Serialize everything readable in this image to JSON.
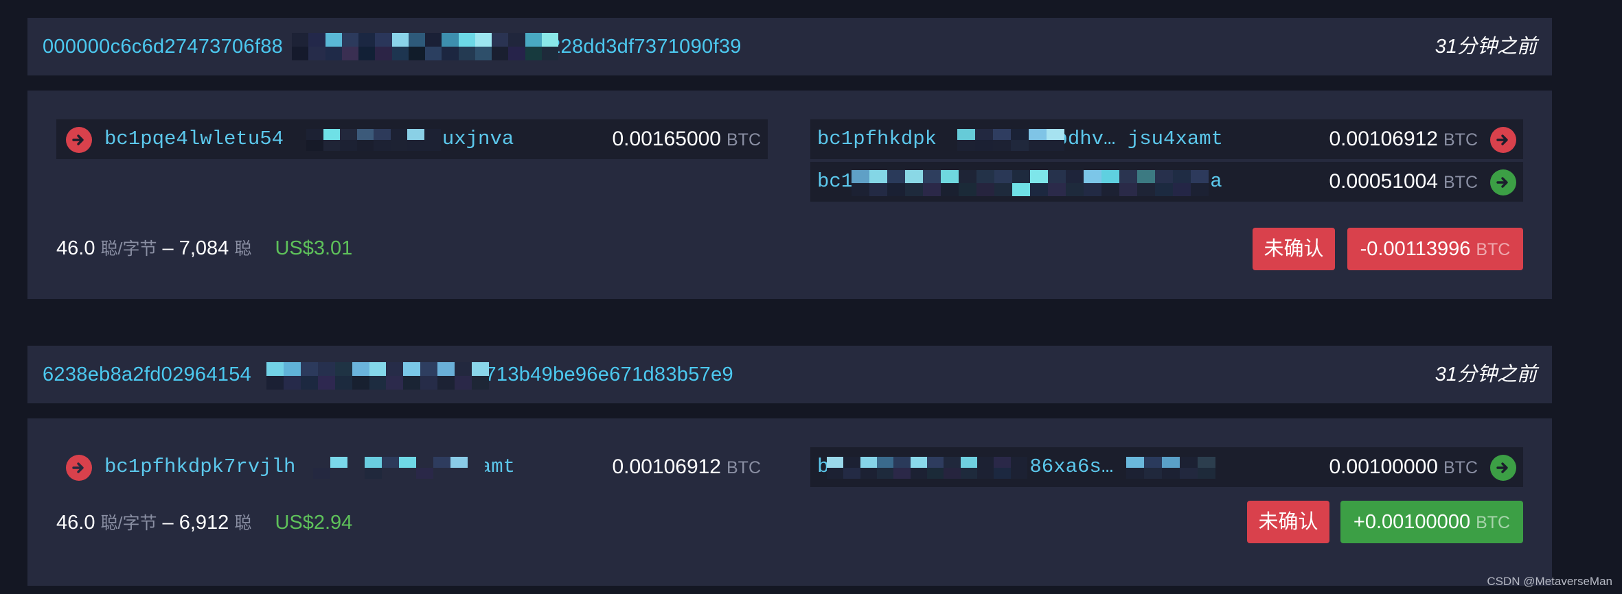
{
  "transactions": [
    {
      "hash": "000000c6c6d27473706f88▇▇▇▇▇▇▇▇▇▇▇▇228dd3df7371090f39",
      "hash_prefix": "000000c6c6d27473706f88",
      "hash_suffix": "228dd3df7371090f39",
      "time": "31分钟之前",
      "inputs": [
        {
          "address_prefix": "bc1pqe4lwletu54",
          "address_suffix": "ysuxjnva",
          "amount": "0.00165000",
          "unit": "BTC",
          "arrow": "arrow-right-icon"
        }
      ],
      "outputs": [
        {
          "address_prefix": "bc1pfhkdpk",
          "address_suffix": "apdhv… jsu4xamt",
          "amount": "0.00106912",
          "unit": "BTC",
          "arrow": "arrow-right-icon"
        },
        {
          "address_prefix": "bc1",
          "address_suffix": "a",
          "amount": "0.00051004",
          "unit": "BTC",
          "arrow": "arrow-right-icon"
        }
      ],
      "fee_rate": "46.0",
      "fee_rate_unit": "聪/字节",
      "separator": "–",
      "fee": "7,084",
      "fee_unit": "聪",
      "fee_usd": "US$3.01",
      "status": "未确认",
      "net": "-0.00113996",
      "net_unit": "BTC"
    },
    {
      "hash": "6238eb8a2fd02964154▇▇▇▇▇▇▇▇▇▇▇▇2713b49be96e671d83b57e9",
      "hash_prefix": "6238eb8a2fd02964154",
      "hash_suffix": "2713b49be96e671d83b57e9",
      "time": "31分钟之前",
      "inputs": [
        {
          "address_prefix": "bc1pfhkdpk7rvjlh",
          "address_suffix": "kamt",
          "amount": "0.00106912",
          "unit": "BTC",
          "arrow": "arrow-right-icon"
        }
      ],
      "outputs": [
        {
          "address_prefix": "b",
          "address_suffix": "86xa6s… y",
          "amount": "0.00100000",
          "unit": "BTC",
          "arrow": "arrow-right-icon"
        }
      ],
      "fee_rate": "46.0",
      "fee_rate_unit": "聪/字节",
      "separator": "–",
      "fee": "6,912",
      "fee_unit": "聪",
      "fee_usd": "US$2.94",
      "status": "未确认",
      "net": "+0.00100000",
      "net_unit": "BTC"
    }
  ],
  "watermark": "CSDN @MetaverseMan",
  "colors": {
    "link": "#4cc9f0",
    "negative": "#d9414c",
    "positive": "#3c9f45",
    "usd": "#5ec15a",
    "panel": "#262a3e",
    "background": "#141723"
  }
}
